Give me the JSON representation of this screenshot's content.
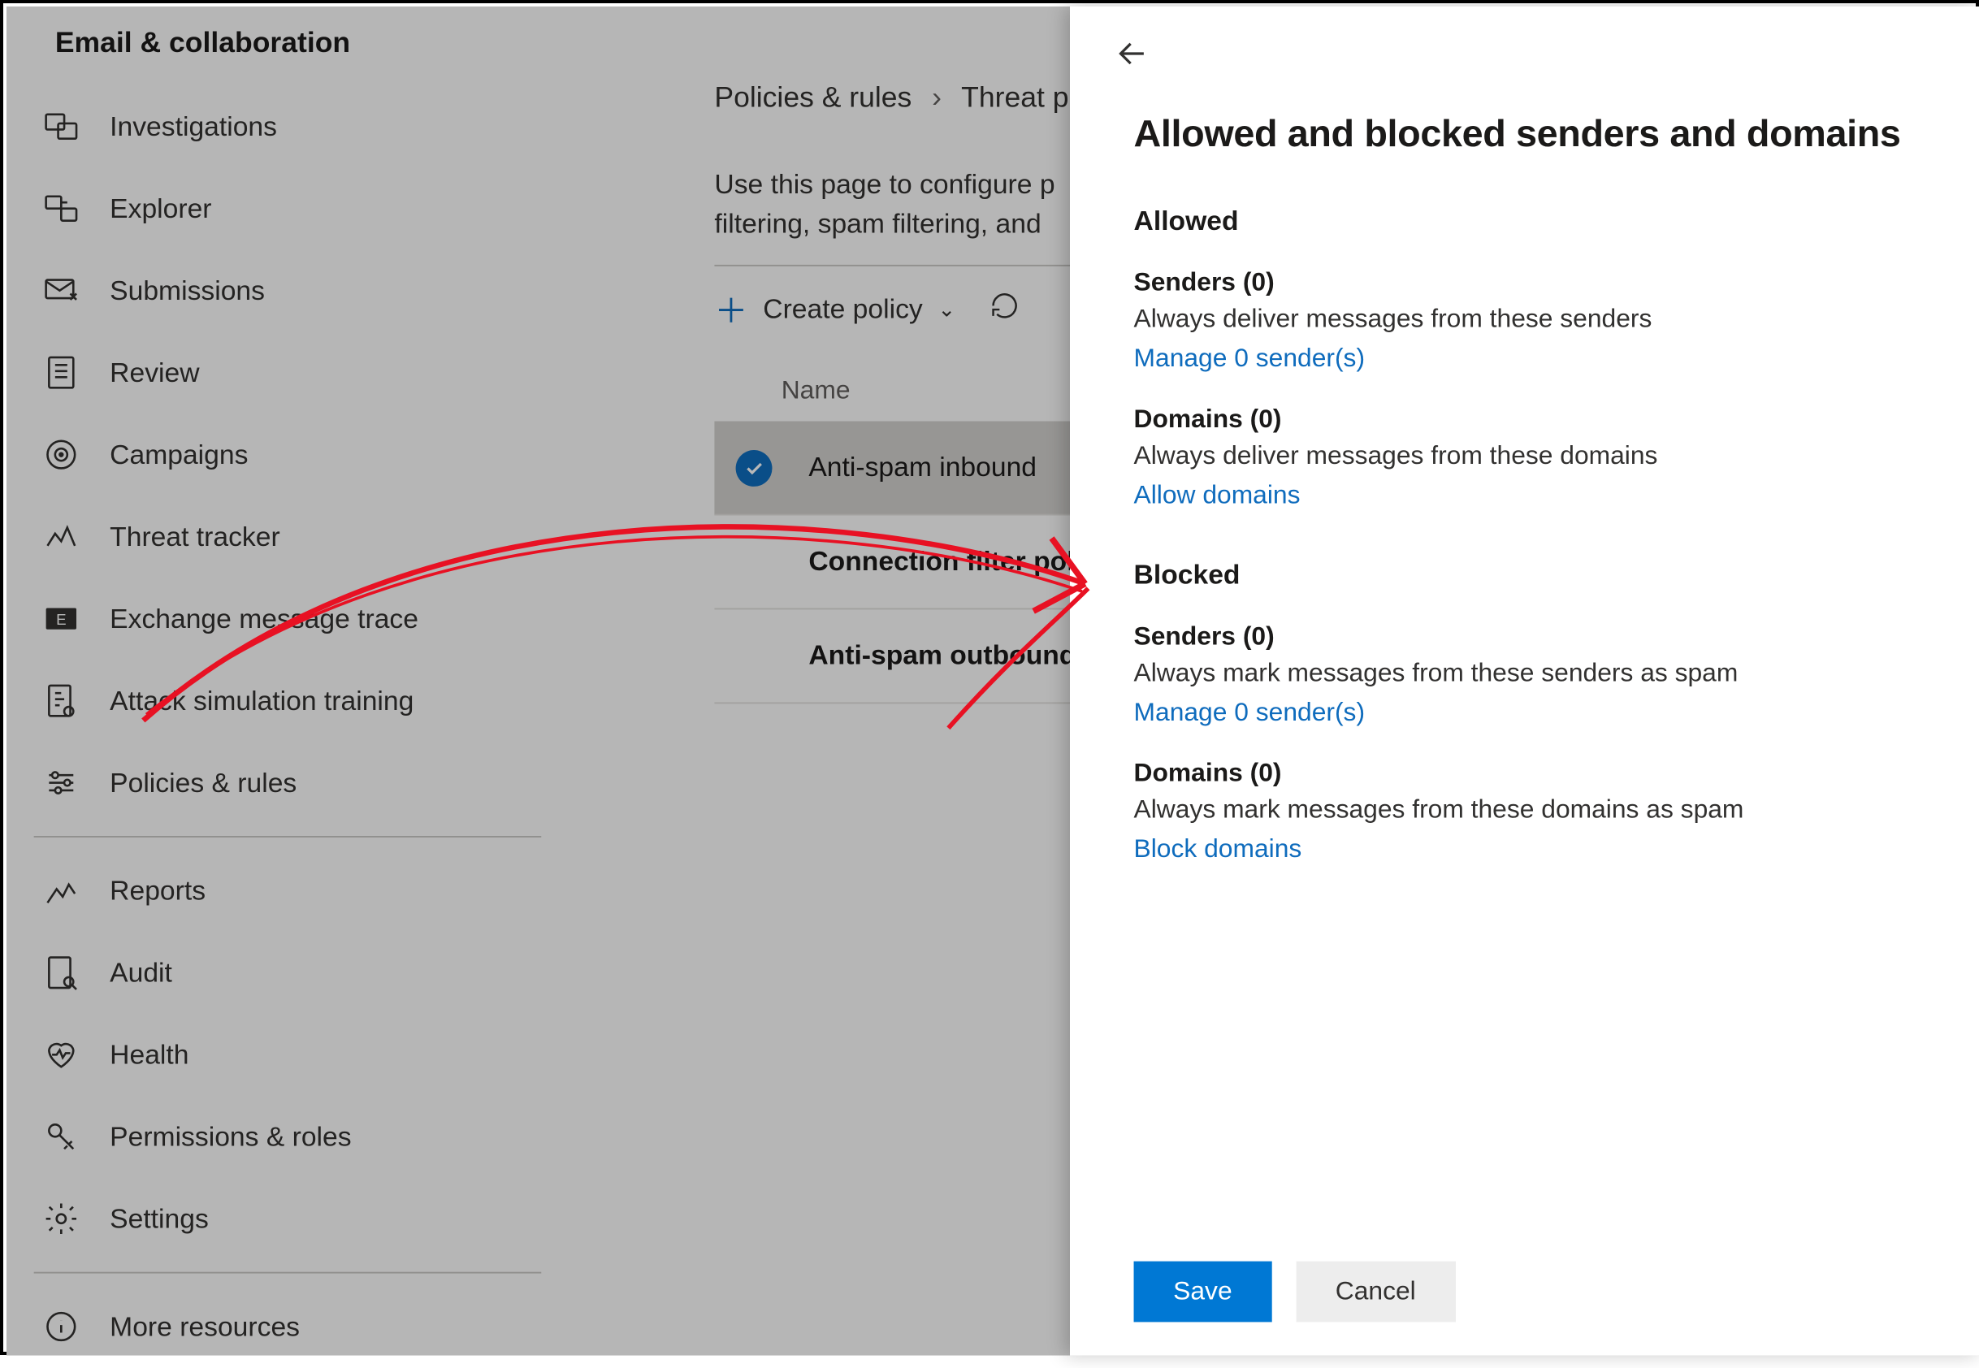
{
  "sidebar": {
    "section": "Email & collaboration",
    "items": [
      {
        "label": "Investigations"
      },
      {
        "label": "Explorer"
      },
      {
        "label": "Submissions"
      },
      {
        "label": "Review"
      },
      {
        "label": "Campaigns"
      },
      {
        "label": "Threat tracker"
      },
      {
        "label": "Exchange message trace"
      },
      {
        "label": "Attack simulation training"
      },
      {
        "label": "Policies & rules"
      }
    ],
    "below": [
      {
        "label": "Reports"
      },
      {
        "label": "Audit"
      },
      {
        "label": "Health"
      },
      {
        "label": "Permissions & roles"
      },
      {
        "label": "Settings"
      }
    ],
    "more": "More resources"
  },
  "main": {
    "breadcrumb": {
      "a": "Policies & rules",
      "b": "Threat p"
    },
    "description": "Use this page to configure p\nfiltering, spam filtering, and",
    "create": "Create policy",
    "table_header": "Name",
    "rows": [
      {
        "name": "Anti-spam inbound",
        "selected": true,
        "bold": false
      },
      {
        "name": "Connection filter pol",
        "selected": false,
        "bold": true
      },
      {
        "name": "Anti-spam outbound",
        "selected": false,
        "bold": true
      }
    ]
  },
  "panel": {
    "title": "Allowed and blocked senders and domains",
    "allowed": {
      "heading": "Allowed",
      "senders": {
        "title": "Senders (0)",
        "desc": "Always deliver messages from these senders",
        "link": "Manage 0 sender(s)"
      },
      "domains": {
        "title": "Domains (0)",
        "desc": "Always deliver messages from these domains",
        "link": "Allow domains"
      }
    },
    "blocked": {
      "heading": "Blocked",
      "senders": {
        "title": "Senders (0)",
        "desc": "Always mark messages from these senders as spam",
        "link": "Manage 0 sender(s)"
      },
      "domains": {
        "title": "Domains (0)",
        "desc": "Always mark messages from these domains as spam",
        "link": "Block domains"
      }
    },
    "save": "Save",
    "cancel": "Cancel"
  }
}
